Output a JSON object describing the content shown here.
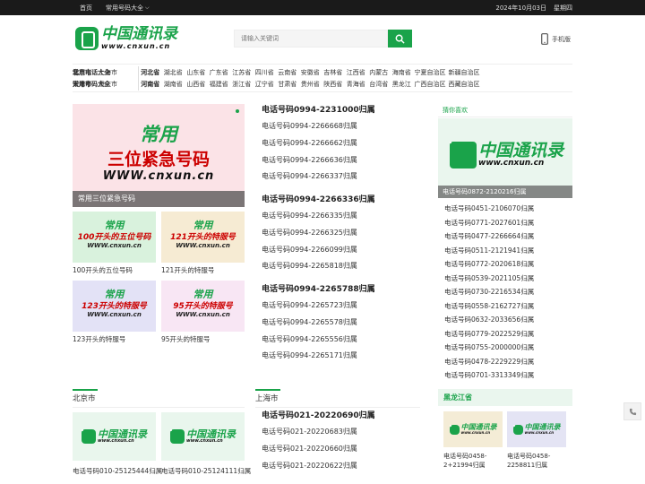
{
  "topbar": {
    "home": "首页",
    "common_numbers": "常用号码大全",
    "date": "2024年10月03日",
    "weekday": "星期四"
  },
  "logo": {
    "cn": "中国通讯录",
    "en": "www.cnxun.cn"
  },
  "search": {
    "placeholder": "请输入关键词"
  },
  "mobile": "手机版",
  "region": {
    "row1_cities": [
      "北京市",
      "上海市"
    ],
    "row2_cities": [
      "天津市",
      "重庆市"
    ],
    "row1_provs": [
      "河北省",
      "湖北省",
      "山东省",
      "广东省",
      "江苏省",
      "四川省",
      "云南省",
      "安徽省",
      "吉林省",
      "江西省",
      "内蒙古",
      "海南省",
      "宁夏自治区",
      "新疆自治区"
    ],
    "row2_provs": [
      "河南省",
      "湖南省",
      "山西省",
      "福建省",
      "浙江省",
      "辽宁省",
      "甘肃省",
      "贵州省",
      "陕西省",
      "青海省",
      "台湾省",
      "黑龙江",
      "广西自治区",
      "西藏自治区"
    ],
    "row1_extra": "常用电话大全",
    "row2_extra": "常用号码大全"
  },
  "feature": {
    "line1": "常用",
    "line2": "三位紧急号码",
    "line3": "WWW.cnxun.cn",
    "caption": "常用三位紧急号码"
  },
  "thumbs": [
    {
      "top": "常用",
      "mid": "100开头的五位号码",
      "url": "WWW.cnxun.cn",
      "caption": "100开头的五位号码",
      "bg": "#d9f2dd"
    },
    {
      "top": "常用",
      "mid": "121开头的特服号",
      "url": "WWW.cnxun.cn",
      "caption": "121开头的特服号",
      "bg": "#f6ebd3"
    },
    {
      "top": "常用",
      "mid": "123开头的特服号",
      "url": "WWW.cnxun.cn",
      "caption": "123开头的特服号",
      "bg": "#e3e2f6"
    },
    {
      "top": "常用",
      "mid": "95开头的特服号",
      "url": "WWW.cnxun.cn",
      "caption": "95开头的特服号",
      "bg": "#f8e6f4"
    }
  ],
  "middle": {
    "groups": [
      {
        "heading": "电话号码0994-2231000归属",
        "items": [
          "电话号码0994-2266668归属",
          "电话号码0994-2266662归属",
          "电话号码0994-2266636归属",
          "电话号码0994-2266337归属"
        ]
      },
      {
        "heading": "电话号码0994-2266336归属",
        "items": [
          "电话号码0994-2266335归属",
          "电话号码0994-2266325归属",
          "电话号码0994-2266099归属",
          "电话号码0994-2265818归属"
        ]
      },
      {
        "heading": "电话号码0994-2265788归属",
        "items": [
          "电话号码0994-2265723归属",
          "电话号码0994-2265578归属",
          "电话号码0994-2265556归属",
          "电话号码0994-2265171归属"
        ]
      }
    ]
  },
  "guess": {
    "title": "猜你喜欢",
    "feature_caption": "电话号码0872-2120216归属",
    "items": [
      "电话号码0451-2106070归属",
      "电话号码0771-2027601归属",
      "电话号码0477-2266664归属",
      "电话号码0511-2121941归属",
      "电话号码0772-2020618归属",
      "电话号码0539-2021105归属",
      "电话号码0730-2216534归属",
      "电话号码0558-2162727归属",
      "电话号码0632-2033656归属",
      "电话号码0779-2022529归属",
      "电话号码0755-2000000归属",
      "电话号码0478-2229229归属",
      "电话号码0701-3313349归属"
    ]
  },
  "beijing": {
    "title": "北京市",
    "cards": [
      "电话号码010-25125444归属",
      "电话号码010-25124111归属"
    ]
  },
  "shanghai": {
    "title": "上海市",
    "heading": "电话号码021-20220690归属",
    "items": [
      "电话号码021-20220683归属",
      "电话号码021-20220660归属",
      "电话号码021-20220622归属",
      "电话号码021-20220607归属"
    ]
  },
  "heilongjiang": {
    "title": "黑龙江省",
    "cards": [
      "电话号码0458-2+21994归属",
      "电话号码0458-2258811归属"
    ]
  },
  "colors": {
    "brand": "#1aa34a",
    "topbar": "#1a1a1a"
  }
}
